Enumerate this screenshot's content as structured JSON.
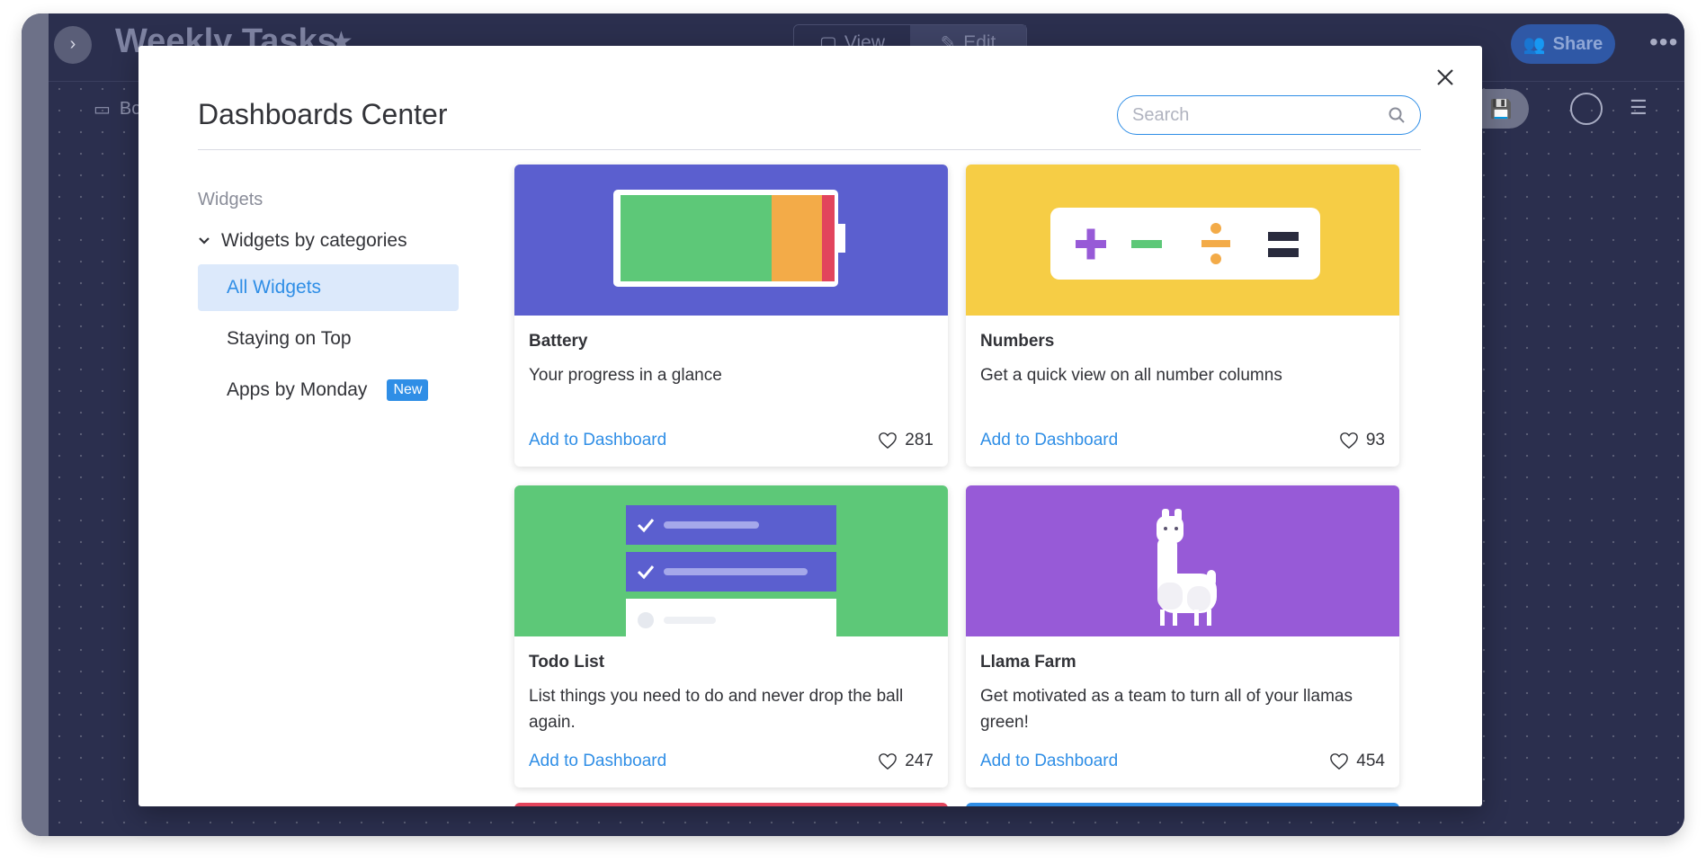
{
  "app": {
    "title": "Weekly Tasks",
    "view_label": "View",
    "edit_label": "Edit",
    "share_label": "Share",
    "board_label": "Bo"
  },
  "modal": {
    "title": "Dashboards Center",
    "search_placeholder": "Search",
    "search_value": ""
  },
  "sidebar": {
    "section_label": "Widgets",
    "category_label": "Widgets by categories",
    "items": [
      {
        "label": "All Widgets",
        "active": true
      },
      {
        "label": "Staying on Top",
        "active": false
      },
      {
        "label": "Apps by Monday",
        "active": false,
        "badge": "New"
      }
    ]
  },
  "cards": [
    {
      "title": "Battery",
      "description": "Your progress in a glance",
      "action": "Add to Dashboard",
      "likes": "281",
      "image_color": "#5b5fcf"
    },
    {
      "title": "Numbers",
      "description": "Get a quick view on all number columns",
      "action": "Add to Dashboard",
      "likes": "93",
      "image_color": "#f6cd45"
    },
    {
      "title": "Todo List",
      "description": "List things you need to do and never drop the ball again.",
      "action": "Add to Dashboard",
      "likes": "247",
      "image_color": "#5dc878"
    },
    {
      "title": "Llama Farm",
      "description": "Get motivated as a team to turn all of your llamas green!",
      "action": "Add to Dashboard",
      "likes": "454",
      "image_color": "#975ad7"
    }
  ],
  "colors": {
    "accent": "#2f8ee6",
    "battery_green": "#5dc878",
    "battery_orange": "#f3ab48",
    "battery_red": "#e2445c",
    "purple": "#5b5fcf",
    "yellow": "#f6cd45"
  }
}
